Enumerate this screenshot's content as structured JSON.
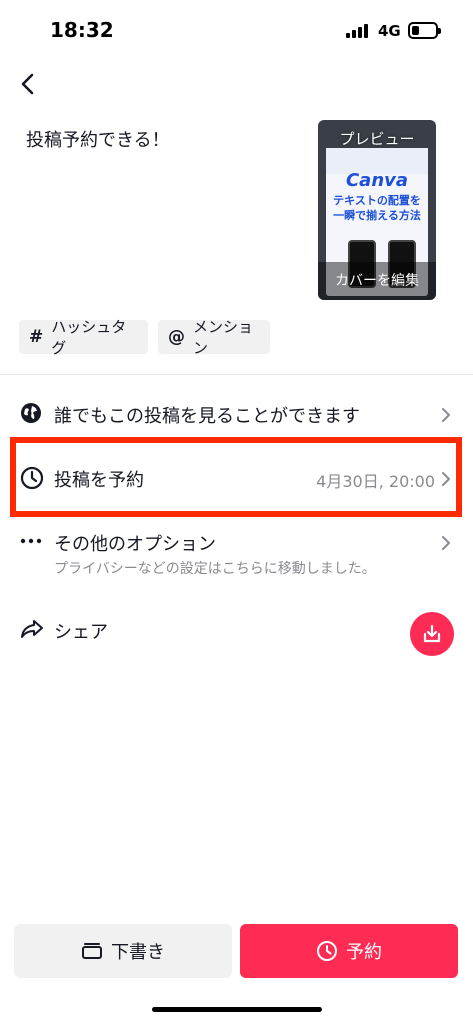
{
  "status_bar": {
    "time": "18:32",
    "network": "4G",
    "battery_level": 0.3
  },
  "header": {
    "back_icon": "chevron-left-icon"
  },
  "post": {
    "caption": "投稿予約できる！",
    "thumbnail": {
      "preview_label": "プレビュー",
      "edit_cover_label": "カバーを編集",
      "content_title": "Canva",
      "content_line1": "テキストの配置を",
      "content_line2": "一瞬で揃える方法"
    }
  },
  "chips": {
    "hashtag": {
      "symbol": "#",
      "label": "ハッシュタグ"
    },
    "mention": {
      "symbol": "@",
      "label": "メンション"
    }
  },
  "settings": {
    "privacy": {
      "label": "誰でもこの投稿を見ることができます",
      "icon": "globe-icon"
    },
    "schedule": {
      "label": "投稿を予約",
      "value": "4月30日, 20:00",
      "icon": "clock-icon"
    },
    "options": {
      "label": "その他のオプション",
      "sub": "プライバシーなどの設定はこちらに移動しました。",
      "icon": "more-dots-icon"
    },
    "share": {
      "label": "シェア",
      "icon": "share-arrow-icon"
    }
  },
  "buttons": {
    "draft": "下書き",
    "schedule": "予約"
  },
  "colors": {
    "accent": "#fe2c55",
    "highlight": "#ff2a00",
    "text": "#161823",
    "muted": "#8a8b91"
  }
}
